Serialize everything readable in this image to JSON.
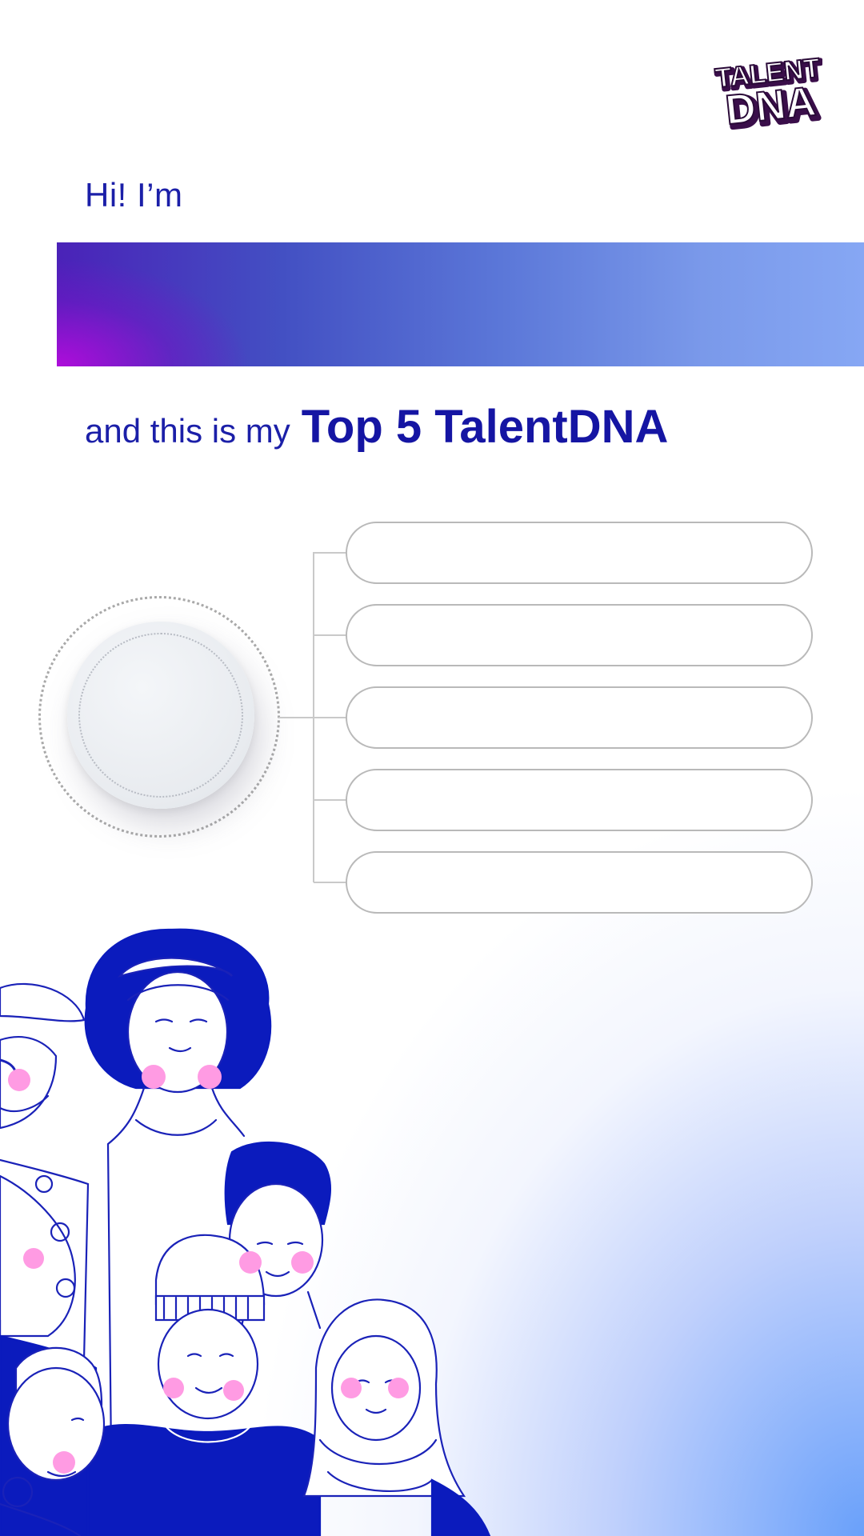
{
  "brand": {
    "logo_line1": "TALENT",
    "logo_line2": "DNA",
    "primary_color": "#1b1fa8",
    "accent_purple": "#b40cdc",
    "accent_blue": "#619bfa"
  },
  "header": {
    "greeting": "Hi! I’m"
  },
  "name_field": {
    "value": ""
  },
  "subtitle": {
    "lead": "and this is my",
    "emphasis": "Top 5 TalentDNA"
  },
  "talents": {
    "slots": [
      "",
      "",
      "",
      "",
      ""
    ]
  },
  "icons": {
    "dial": "badge-dial-icon",
    "illustration": "people-group-illustration"
  }
}
